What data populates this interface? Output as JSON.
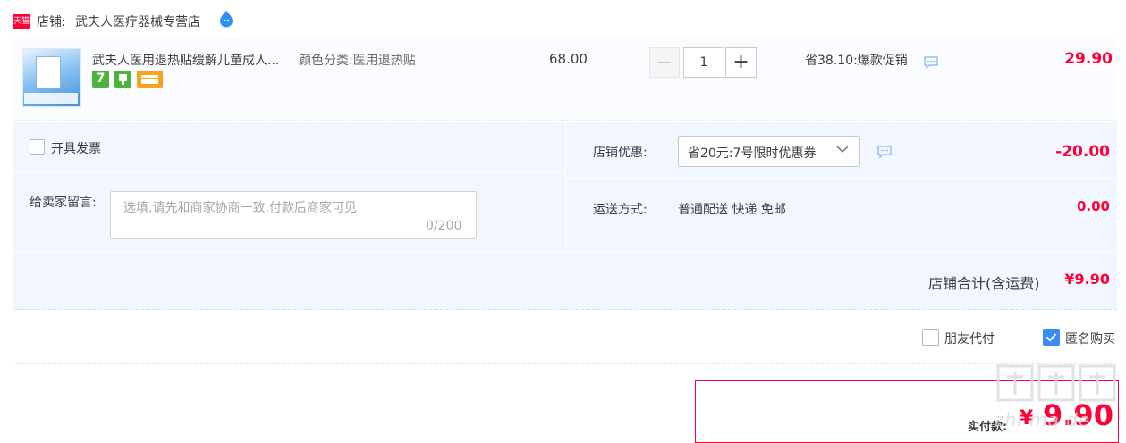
{
  "shop": {
    "badge": "天猫",
    "label": "店铺:",
    "name": "武夫人医疗器械专营店"
  },
  "item": {
    "title": "武夫人医用退热贴缓解儿童成人...",
    "sku": "颜色分类:医用退热贴",
    "service_badge_1": "7",
    "unit_price": "68.00",
    "quantity": "1",
    "minus_label": "−",
    "plus_label": "+",
    "promotion": "省38.10:爆款促销",
    "total": "29.90"
  },
  "options": {
    "invoice_label": "开具发票",
    "memo_label": "给卖家留言:",
    "memo_placeholder": "选填,请先和商家协商一致,付款后商家可见",
    "memo_counter": "0/200",
    "coupon_label": "店铺优惠:",
    "coupon_value": "省20元:7号限时优惠券",
    "coupon_amount": "-20.00",
    "shipping_label": "运送方式:",
    "shipping_value": "普通配送 快递 免邮",
    "shipping_amount": "0.00",
    "subtotal_label": "店铺合计(含运费)",
    "subtotal_amount": "¥9.90"
  },
  "checkout": {
    "friend_pay_label": "朋友代付",
    "friend_pay_checked": false,
    "anonymous_label": "匿名购买",
    "anonymous_checked": true,
    "pay_label": "实付款:",
    "pay_currency": "¥",
    "pay_amount": "9.90"
  },
  "watermark": {
    "text": "zhi ma de"
  },
  "colors": {
    "accent": "#ff0036",
    "panel": "#f2f7ff",
    "checkbox_checked": "#3b8cf0"
  }
}
